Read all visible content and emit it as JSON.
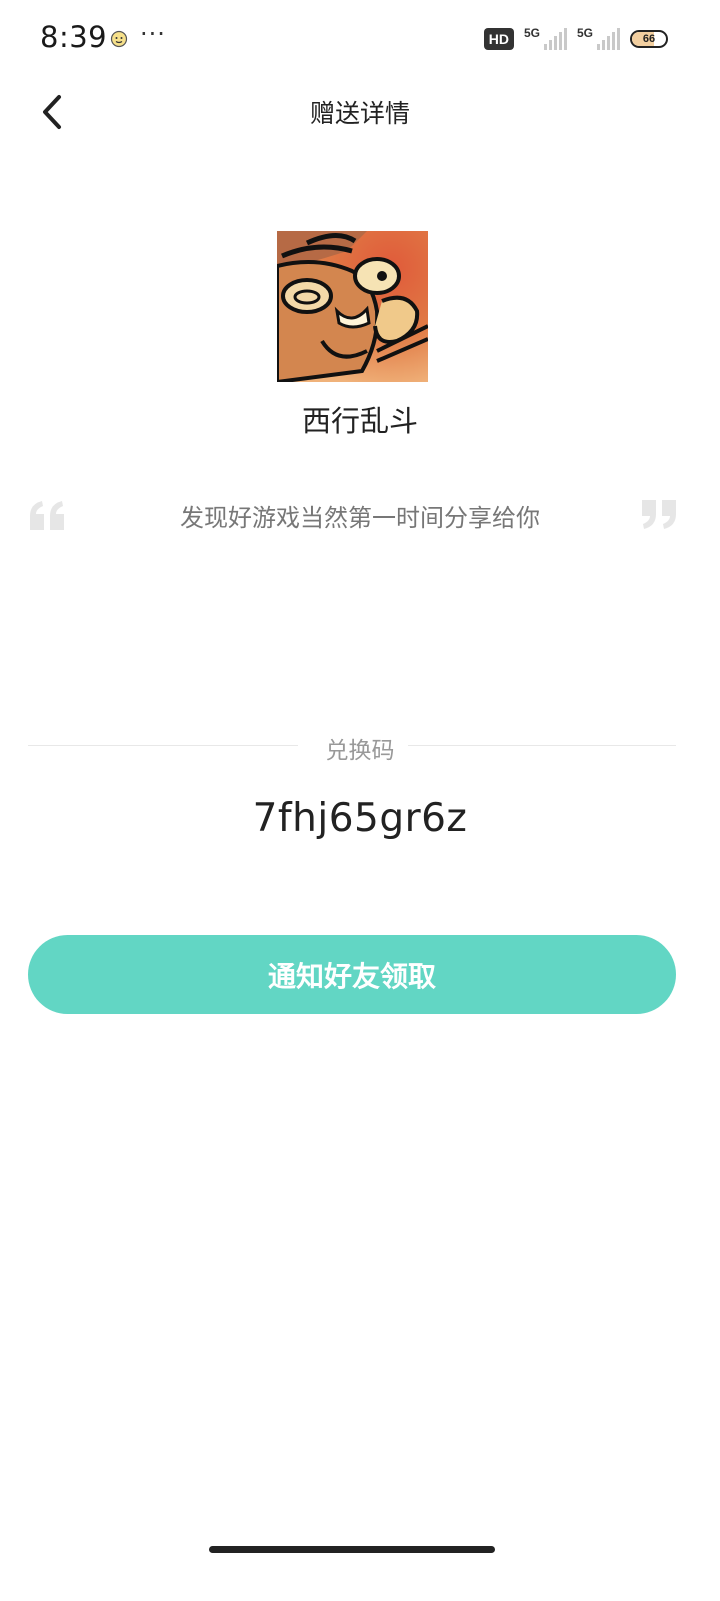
{
  "status_bar": {
    "time": "8:39",
    "hd_badge": "HD",
    "network_1": "5G",
    "network_2": "5G",
    "battery": "66",
    "menu_glyph": "···"
  },
  "header": {
    "title": "赠送详情",
    "back_icon": "chevron-left-icon"
  },
  "game": {
    "name": "西行乱斗"
  },
  "quote": {
    "text": "发现好游戏当然第一时间分享给你"
  },
  "redeem": {
    "label": "兑换码",
    "code": "7fhj65gr6z"
  },
  "actions": {
    "notify_label": "通知好友领取"
  },
  "colors": {
    "accent": "#62d6c4",
    "quote_mark": "#e6e6e6"
  }
}
